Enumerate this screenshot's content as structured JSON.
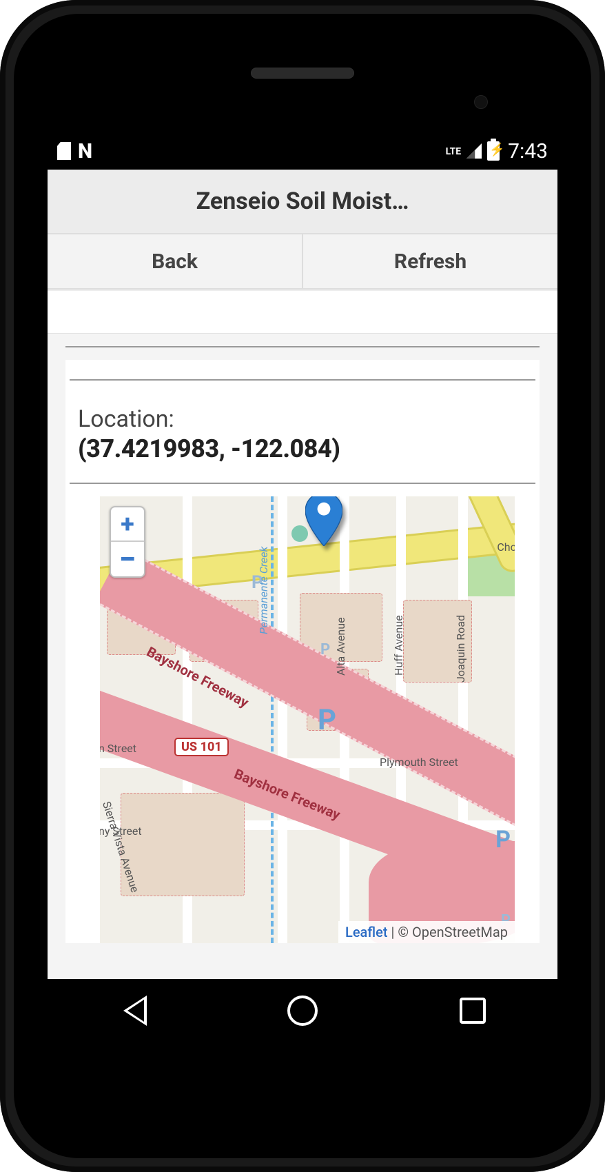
{
  "status": {
    "network": "LTE",
    "time": "7:43"
  },
  "app": {
    "title": "Zenseio Soil Moist…"
  },
  "buttons": {
    "back": "Back",
    "refresh": "Refresh"
  },
  "location": {
    "label": "Location:",
    "coords": "(37.4219983, -122.084)"
  },
  "map": {
    "zoom_in": "+",
    "zoom_out": "−",
    "shield": "US 101",
    "labels": {
      "permanente": "Permanente Creek",
      "alta": "Alta Avenue",
      "huff": "Huff Avenue",
      "joaquin": "Joaquin Road",
      "plymouth": "Plymouth Street",
      "sierra": "Sierra Vista Avenue",
      "nstreet": "n Street",
      "nystreet": "ny Street",
      "cha": "Chc",
      "freeway": "Bayshore Freeway",
      "p": "P"
    },
    "attribution": {
      "leaflet": "Leaflet",
      "sep": " | © ",
      "osm": "OpenStreetMap"
    }
  }
}
